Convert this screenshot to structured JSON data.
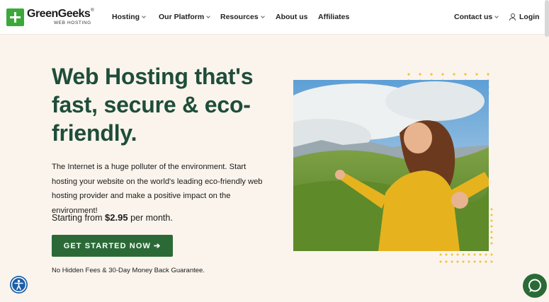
{
  "brand": {
    "name": "GreenGeeks",
    "registered": "®",
    "tagline": "WEB HOSTING",
    "color": "#3aa93a"
  },
  "nav": {
    "items": [
      {
        "label": "Hosting",
        "has_dropdown": true
      },
      {
        "label": "Our Platform",
        "has_dropdown": true
      },
      {
        "label": "Resources",
        "has_dropdown": true
      },
      {
        "label": "About us",
        "has_dropdown": false
      },
      {
        "label": "Affiliates",
        "has_dropdown": false
      }
    ],
    "contact": {
      "label": "Contact us",
      "has_dropdown": true
    },
    "login": {
      "label": "Login",
      "icon": "user-icon"
    }
  },
  "hero": {
    "headline": "Web Hosting that's fast, secure & eco-friendly.",
    "description": "The Internet is a huge polluter of the environment. Start hosting your website on the world's leading eco-friendly web hosting provider and make a positive impact on the environment!",
    "price_prefix": "Starting from",
    "price_value": "$2.95",
    "price_suffix": "per month.",
    "cta_label": "GET STARTED NOW",
    "cta_icon": "arrow-right-icon",
    "guarantee": "No Hidden Fees & 30-Day Money Back Guarantee."
  },
  "colors": {
    "headline": "#1f4d3a",
    "cta": "#2b6a37",
    "background": "#faf4ec",
    "dots": "#f0c23b",
    "accessibility": "#1a5fa8"
  },
  "widgets": {
    "accessibility_icon": "accessibility-icon",
    "chat_icon": "chat-icon"
  }
}
